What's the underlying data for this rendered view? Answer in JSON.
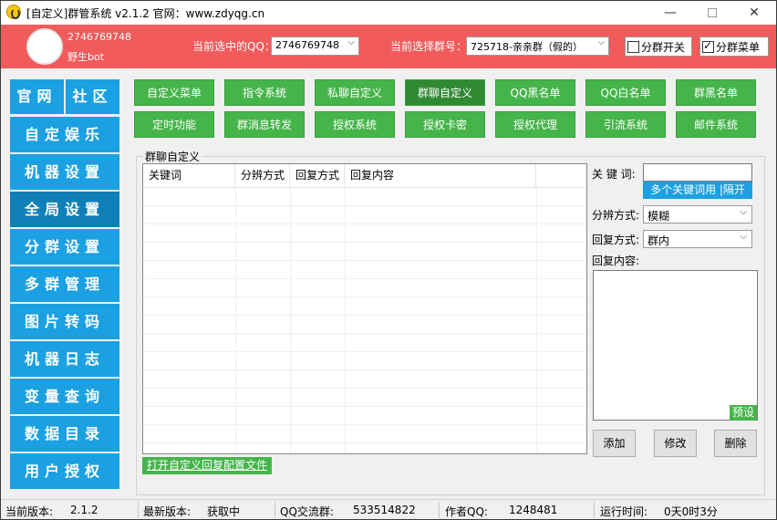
{
  "window": {
    "title": "[自定义]群管系统 v2.1.2 官网：www.zdyqg.cn",
    "minimize": "—",
    "close": "✕"
  },
  "header": {
    "qq_number": "2746769748",
    "bot_name": "野生bot",
    "current_qq_label": "当前选中的QQ：",
    "current_qq_value": "2746769748",
    "current_group_label": "当前选择群号：",
    "current_group_value": "725718-亲亲群（假的）",
    "split_switch_label": "分群开关",
    "split_menu_label": "分群菜单",
    "split_switch_checked": false,
    "split_menu_checked": true
  },
  "sidebar": {
    "top": [
      "官网",
      "社区"
    ],
    "items": [
      "自定娱乐",
      "机器设置",
      "全局设置",
      "分群设置",
      "多群管理",
      "图片转码",
      "机器日志",
      "变量查询",
      "数据目录",
      "用户授权"
    ],
    "active_index": 2
  },
  "toolbar": {
    "row1": [
      "自定义菜单",
      "指令系统",
      "私聊自定义",
      "群聊自定义",
      "QQ黑名单",
      "QQ白名单",
      "群黑名单"
    ],
    "row2": [
      "定时功能",
      "群消息转发",
      "授权系统",
      "授权卡密",
      "授权代理",
      "引流系统",
      "邮件系统"
    ],
    "active": "群聊自定义"
  },
  "panel": {
    "title": "群聊自定义",
    "columns": [
      "关键词",
      "分辨方式",
      "回复方式",
      "回复内容"
    ],
    "open_config_label": "打开自定义回复配置文件",
    "keyword_label": "关 键 词:",
    "keyword_value": "",
    "keyword_hint": "多个关键词用 |隔开",
    "match_mode_label": "分辨方式:",
    "match_mode_value": "模糊",
    "reply_mode_label": "回复方式:",
    "reply_mode_value": "群内",
    "reply_content_label": "回复内容:",
    "preset_label": "预设",
    "add_label": "添加",
    "edit_label": "修改",
    "delete_label": "删除"
  },
  "status": {
    "current_version_label": "当前版本:",
    "current_version": "2.1.2",
    "latest_version_label": "最新版本:",
    "latest_version": "获取中",
    "group_label": "QQ交流群:",
    "group_value": "533514822",
    "author_label": "作者QQ:",
    "author_value": "1248481",
    "uptime_label": "运行时间:",
    "uptime_value": "0天0时3分"
  },
  "colors": {
    "header_bg": "#f15b5b",
    "sidebar_bg": "#1ba0e2",
    "sidebar_active": "#0f7fb8",
    "button_green": "#45b549"
  }
}
